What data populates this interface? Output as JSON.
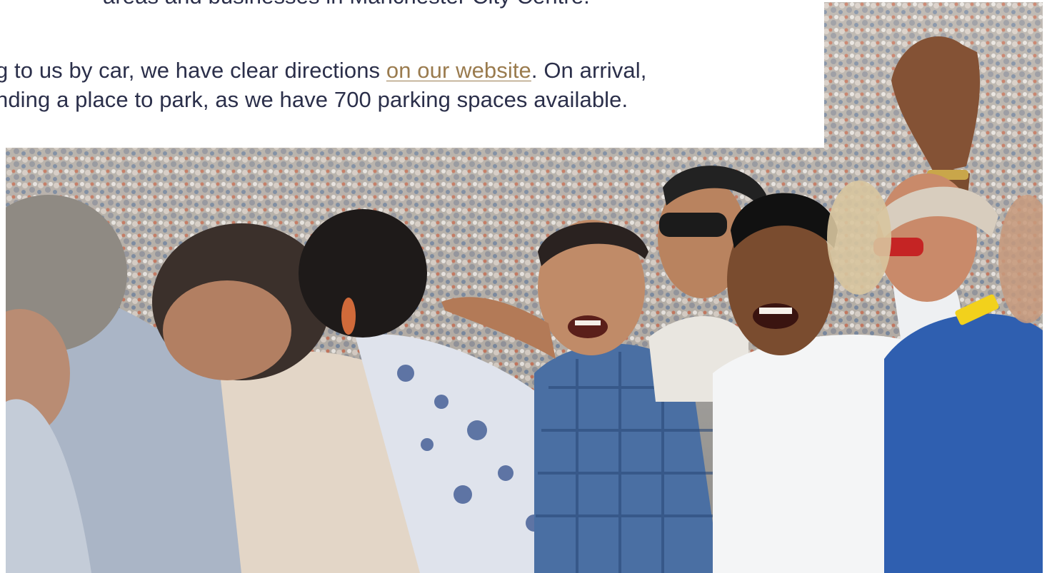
{
  "intro": {
    "line1_tail": "areas and businesses in Manchester City Centre."
  },
  "directions": {
    "line1_start": "g to us by car, we have clear directions ",
    "link_text": "on our website",
    "line1_end": ". On arrival,",
    "line2": "nding a place to park, as we have 700 parking spaces available."
  },
  "photo": {
    "icon": "crowd-photo",
    "alt": ""
  },
  "colors": {
    "text": "#2b2f4a",
    "link": "#9a7b4e",
    "background": "#ffffff"
  }
}
